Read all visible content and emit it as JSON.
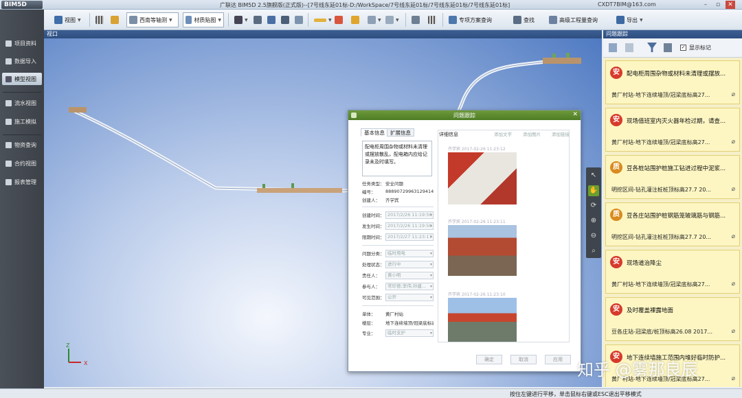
{
  "app": {
    "logo": "BIM5D",
    "window_title": "广联达 BIM5D 2.5旗舰版(正式版)--[7号线东延01标-D:/WorkSpace/7号线东延01标/7号线东延01标/7号线东延01标]",
    "user_email": "CXDT7BIM@163.com"
  },
  "toolbar": {
    "view_label": "视图",
    "projection_label": "西南等轴测",
    "material_label": "材质贴图",
    "special_query_label": "专项方案查询",
    "find_label": "查找",
    "advanced_query_label": "高级工程量查询",
    "export_label": "导出"
  },
  "leftnav": {
    "items": [
      {
        "label": "项目资料"
      },
      {
        "label": "数据导入"
      },
      {
        "label": "模型视图"
      },
      {
        "label": "流水视图"
      },
      {
        "label": "施工模拟"
      },
      {
        "label": "物资查询"
      },
      {
        "label": "合约视图"
      },
      {
        "label": "报表管理"
      }
    ]
  },
  "viewport": {
    "header": "视口",
    "axis_x": "X",
    "axis_z": "Z"
  },
  "issue_panel": {
    "header": "问题跟踪",
    "show_markers_label": "显示标记",
    "issues": [
      {
        "badge": "安",
        "title": "配电柜周围杂物或材料未清理或摆放...",
        "location": "黄厂村站-地下连续墙顶/冠梁底标高27..."
      },
      {
        "badge": "安",
        "title": "现场值班室内灭火器年检过期，请查...",
        "location": "黄厂村站-地下连续墙顶/冠梁底标高27..."
      },
      {
        "badge": "质",
        "title": "豆各桩站围护桩施工钻进过程中泥浆...",
        "location": "明挖区间-钻孔灌注桩桩顶标高27.7 20..."
      },
      {
        "badge": "质",
        "title": "豆各庄站围护桩钢筋笼玻璃筋与钢筋...",
        "location": "明挖区间-钻孔灌注桩桩顶标高27.7 20..."
      },
      {
        "badge": "安",
        "title": "现场道治降尘",
        "location": "黄厂村站-地下连续墙顶/冠梁底标高27..."
      },
      {
        "badge": "安",
        "title": "及时覆盖裸露地面",
        "location": "豆各庄站-冠梁底/桩顶标高26.08 2017..."
      },
      {
        "badge": "安",
        "title": "地下连续墙施工范围内堆好临时防护...",
        "location": "黄厂村站-地下连续墙顶/冠梁底标高27..."
      }
    ]
  },
  "dialog": {
    "title": "问题跟踪",
    "tabs": [
      "基本信息",
      "扩展信息"
    ],
    "detail_label": "详细信息",
    "add_text": "添加文字",
    "add_image": "添加图片",
    "add_link": "添加链接",
    "description": "配电柜周围杂物或材料未清理或摆放散乱，配电箱内应给记录未及时填写。",
    "fields": {
      "task_type_label": "任务类型：",
      "task_type": "安全问题",
      "number_label": "编号：",
      "number": "8889072996312941473",
      "creator_label": "创建人：",
      "creator": "齐学宾",
      "created_label": "创建时间：",
      "created": "2017/2/26 11:19:50",
      "occurred_label": "发生时间：",
      "occurred": "2017/2/26 11:19:50",
      "deadline_label": "限期时间：",
      "deadline": "2017/2/27 11:23:17",
      "category_label": "问题分类：",
      "category": "临时用电",
      "status_label": "处理状态：",
      "status": "进行中",
      "owner_label": "责任人：",
      "owner": "黄小明",
      "participants_label": "参与人：",
      "participants": "常珍德;李伟;孙建...",
      "visibility_label": "可见范围：",
      "visibility": "公开",
      "unit_label": "单体：",
      "unit": "黄厂村站",
      "floor_label": "楼层：",
      "floor": "地下连续墙顶/冠梁底标高...",
      "discipline_label": "专业：",
      "discipline": "临时支护"
    },
    "photos": [
      {
        "caption": "齐学宾 2017-02-26 11:23:12"
      },
      {
        "caption": "齐学宾 2017-02-26 11:23:11"
      },
      {
        "caption": "齐学宾 2017-02-26 11:23:10"
      }
    ],
    "btn_confirm": "确定",
    "btn_cancel": "取消",
    "btn_apply": "应用"
  },
  "status_bar": "按住左键进行平移，单击鼠标右键或ESC退出平移模式",
  "watermark": "知乎 @雾那良辰"
}
